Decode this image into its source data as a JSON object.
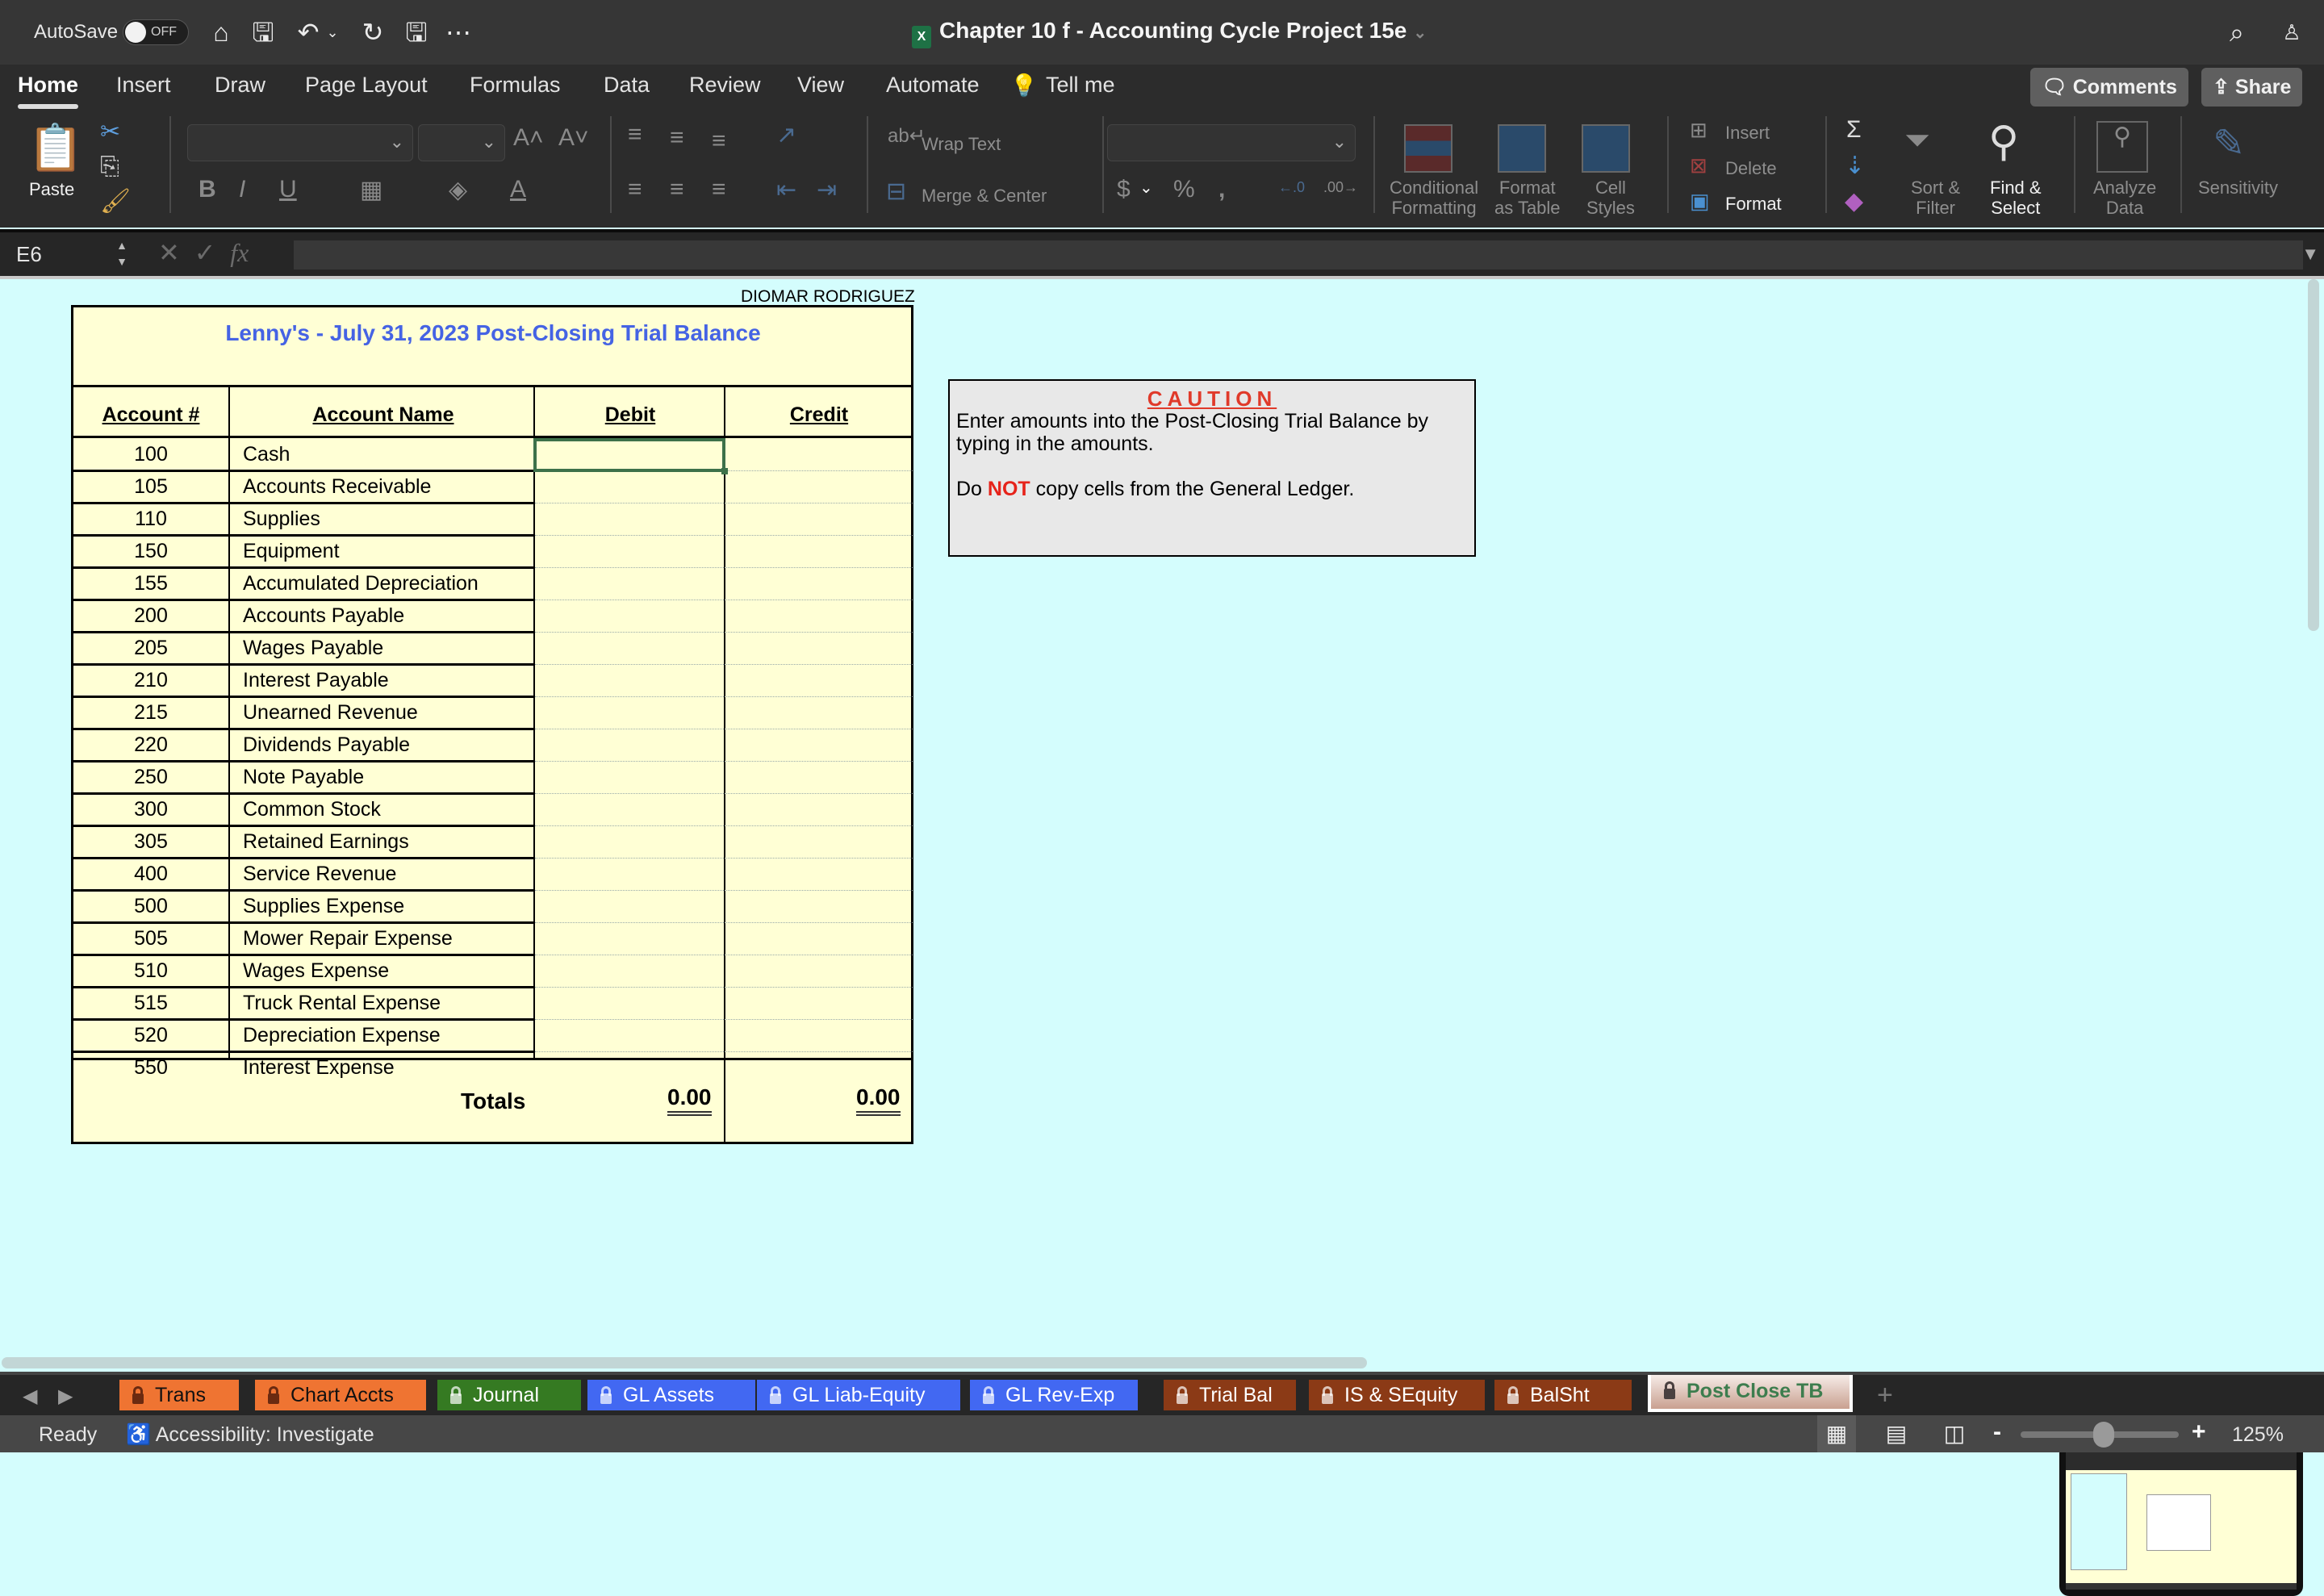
{
  "titlebar": {
    "autosave_label": "AutoSave",
    "autosave_state": "OFF",
    "document_title": "Chapter 10 f - Accounting Cycle Project 15e"
  },
  "menu": {
    "tabs": [
      "Home",
      "Insert",
      "Draw",
      "Page Layout",
      "Formulas",
      "Data",
      "Review",
      "View",
      "Automate"
    ],
    "active_tab": "Home",
    "tell_me": "Tell me",
    "comments": "Comments",
    "share": "Share"
  },
  "ribbon": {
    "paste": "Paste",
    "wrap_text": "Wrap Text",
    "merge_center": "Merge & Center",
    "conditional_formatting": [
      "Conditional",
      "Formatting"
    ],
    "format_as_table": [
      "Format",
      "as Table"
    ],
    "cell_styles": [
      "Cell",
      "Styles"
    ],
    "insert": "Insert",
    "delete": "Delete",
    "format": "Format",
    "sort_filter": [
      "Sort &",
      "Filter"
    ],
    "find_select": [
      "Find &",
      "Select"
    ],
    "analyze_data": [
      "Analyze",
      "Data"
    ],
    "sensitivity": "Sensitivity",
    "font_name": "",
    "font_size": "",
    "number_format": ""
  },
  "formula_bar": {
    "name_box": "E6",
    "formula": ""
  },
  "sheet": {
    "student_name": "DIOMAR RODRIGUEZ",
    "title": "Lenny's  -  July 31, 2023  Post-Closing Trial Balance",
    "headers": {
      "account_num": "Account #",
      "account_name": "Account Name",
      "debit": "Debit",
      "credit": "Credit"
    },
    "accounts": [
      {
        "num": "100",
        "name": "Cash",
        "debit": "",
        "credit": ""
      },
      {
        "num": "105",
        "name": "Accounts Receivable",
        "debit": "",
        "credit": ""
      },
      {
        "num": "110",
        "name": "Supplies",
        "debit": "",
        "credit": ""
      },
      {
        "num": "150",
        "name": "Equipment",
        "debit": "",
        "credit": ""
      },
      {
        "num": "155",
        "name": "Accumulated Depreciation",
        "debit": "",
        "credit": ""
      },
      {
        "num": "200",
        "name": "Accounts Payable",
        "debit": "",
        "credit": ""
      },
      {
        "num": "205",
        "name": "Wages Payable",
        "debit": "",
        "credit": ""
      },
      {
        "num": "210",
        "name": "Interest Payable",
        "debit": "",
        "credit": ""
      },
      {
        "num": "215",
        "name": "Unearned Revenue",
        "debit": "",
        "credit": ""
      },
      {
        "num": "220",
        "name": "Dividends Payable",
        "debit": "",
        "credit": ""
      },
      {
        "num": "250",
        "name": "Note Payable",
        "debit": "",
        "credit": ""
      },
      {
        "num": "300",
        "name": "Common Stock",
        "debit": "",
        "credit": ""
      },
      {
        "num": "305",
        "name": "Retained Earnings",
        "debit": "",
        "credit": ""
      },
      {
        "num": "400",
        "name": "Service Revenue",
        "debit": "",
        "credit": ""
      },
      {
        "num": "500",
        "name": "Supplies Expense",
        "debit": "",
        "credit": ""
      },
      {
        "num": "505",
        "name": "Mower Repair Expense",
        "debit": "",
        "credit": ""
      },
      {
        "num": "510",
        "name": "Wages Expense",
        "debit": "",
        "credit": ""
      },
      {
        "num": "515",
        "name": "Truck Rental Expense",
        "debit": "",
        "credit": ""
      },
      {
        "num": "520",
        "name": "Depreciation Expense",
        "debit": "",
        "credit": ""
      },
      {
        "num": "550",
        "name": "Interest Expense",
        "debit": "",
        "credit": ""
      }
    ],
    "totals_label": "Totals",
    "total_debit": "0.00",
    "total_credit": "0.00",
    "caution": {
      "heading": "CAUTION",
      "line1": "Enter amounts into the Post-Closing Trial Balance by typing in the amounts.",
      "line2_pre": "Do ",
      "line2_emph": "NOT",
      "line2_post": " copy cells from the General Ledger."
    }
  },
  "sheet_tabs": [
    {
      "label": "Trans",
      "color": "#ef7432",
      "locked": true
    },
    {
      "label": "Chart Accts",
      "color": "#ef7432",
      "locked": true
    },
    {
      "label": "Journal",
      "color": "#357a22",
      "locked": true
    },
    {
      "label": "GL Assets",
      "color": "#4268f2",
      "locked": true
    },
    {
      "label": "GL Liab-Equity",
      "color": "#4268f2",
      "locked": true
    },
    {
      "label": "GL Rev-Exp",
      "color": "#4268f2",
      "locked": true
    },
    {
      "label": "Trial Bal",
      "color": "#8b3a16",
      "locked": true
    },
    {
      "label": "IS & SEquity",
      "color": "#8b3a16",
      "locked": true
    },
    {
      "label": "BalSht",
      "color": "#8b3a16",
      "locked": true
    },
    {
      "label": "Post Close TB",
      "color": "#3d7d4e",
      "locked": true,
      "active": true
    }
  ],
  "status": {
    "mode": "Ready",
    "accessibility": "Accessibility: Investigate",
    "zoom": "125%",
    "zoom_value_percent": 125
  },
  "colors": {
    "sheet_bg": "#d4fdfd",
    "table_bg": "#ffffd5",
    "title_blue": "#4563e4",
    "caution_red": "#e03a2a",
    "selection_green": "#3d7149"
  }
}
